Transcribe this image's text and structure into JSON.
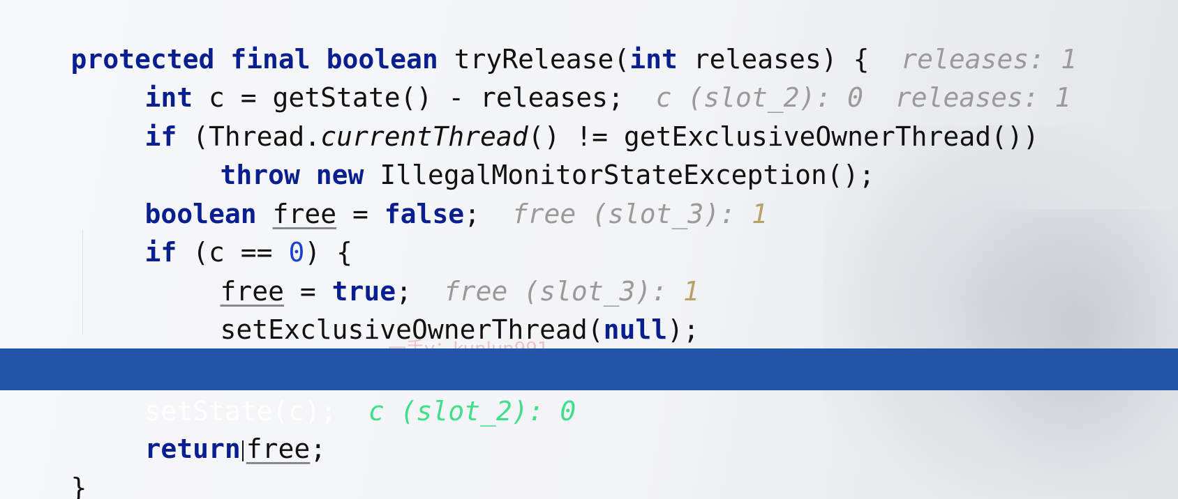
{
  "editor": {
    "watermark": "一手v：kunlun991",
    "lines": [
      {
        "kw1": "protected final boolean",
        "t1": " tryRelease(",
        "kw2": "int",
        "t2": " releases) {",
        "hint": "releases: 1"
      },
      {
        "kw1": "int",
        "t1": " c = getState() - releases;",
        "hint1": "c (slot_2): 0",
        "hint2": "releases: 1"
      },
      {
        "kw1": "if",
        "t1": " (Thread.",
        "ital": "currentThread",
        "t2": "() != getExclusiveOwnerThread())"
      },
      {
        "kw1": "throw new",
        "t1": " IllegalMonitorStateException();"
      },
      {
        "kw1": "boolean",
        "sp": " ",
        "ul": "free",
        "t1": " = ",
        "kw2": "false",
        "t2": ";",
        "hint_label": "free (slot_3): ",
        "hint_num": "1"
      },
      {
        "kw1": "if",
        "t1": " (c == ",
        "num": "0",
        "t2": ") {"
      },
      {
        "ul": "free",
        "t1": " = ",
        "kw1": "true",
        "t2": ";",
        "hint_label": "free (slot_3): ",
        "hint_num": "1"
      },
      {
        "t1": "setExclusiveOwnerThread(",
        "kw1": "null",
        "t2": ");"
      },
      {
        "t1": "}"
      },
      {
        "t1": "setState(c);",
        "hint": "c (slot_2): 0"
      },
      {
        "kw1": "return",
        "ul": "free",
        "t2": ";"
      },
      {
        "t1": "}"
      }
    ]
  }
}
